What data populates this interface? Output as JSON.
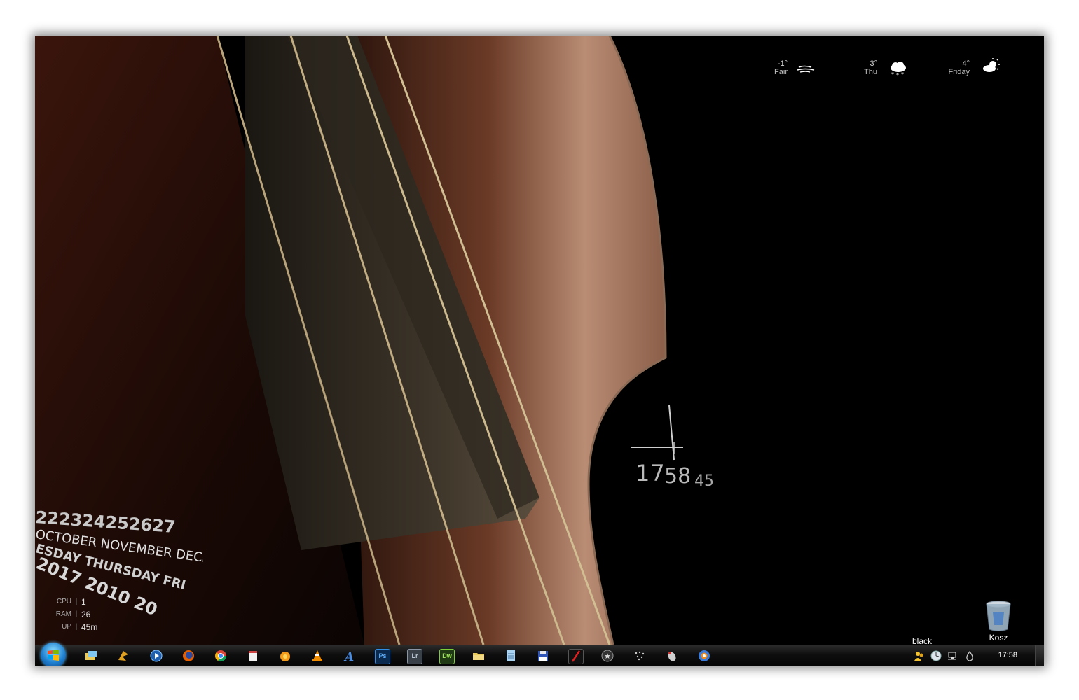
{
  "weather": [
    {
      "temp": "-1°",
      "label": "Fair",
      "icon": "fog-icon"
    },
    {
      "temp": "3°",
      "label": "Thu",
      "icon": "snow-cloud-icon"
    },
    {
      "temp": "4°",
      "label": "Friday",
      "icon": "sun-cloud-icon"
    }
  ],
  "clock": {
    "hours": "17",
    "minutes": "58",
    "seconds": "45"
  },
  "calendar_wheel": {
    "days": "222324252627",
    "months": "OCTOBER NOVEMBER DECEMBER",
    "weekdays": "ESDAY THURSDAY FRI",
    "years": "2017 2010 20"
  },
  "sysmon": [
    {
      "key": "CPU",
      "value": "1"
    },
    {
      "key": "RAM",
      "value": "26"
    },
    {
      "key": "UP",
      "value": "45m"
    }
  ],
  "desktop": {
    "black_label": "black",
    "recycle_label": "Kosz"
  },
  "taskbar": {
    "apps": [
      "windows-explorer-icon",
      "winamp-icon",
      "media-player-icon",
      "firefox-icon",
      "chrome-icon",
      "notepad-icon",
      "orange-app-icon",
      "vlc-icon",
      "text-a-icon",
      "photoshop-icon",
      "lightroom-icon",
      "dreamweaver-icon",
      "folder-icon",
      "document-icon",
      "floppy-save-icon",
      "red-slash-app-icon",
      "star-circle-icon",
      "dotted-icon",
      "mouse-icon",
      "firefox-blue-icon"
    ],
    "ps_label": "Ps",
    "lr_label": "Lr",
    "dw_label": "Dw",
    "tray_time": "17:58"
  }
}
